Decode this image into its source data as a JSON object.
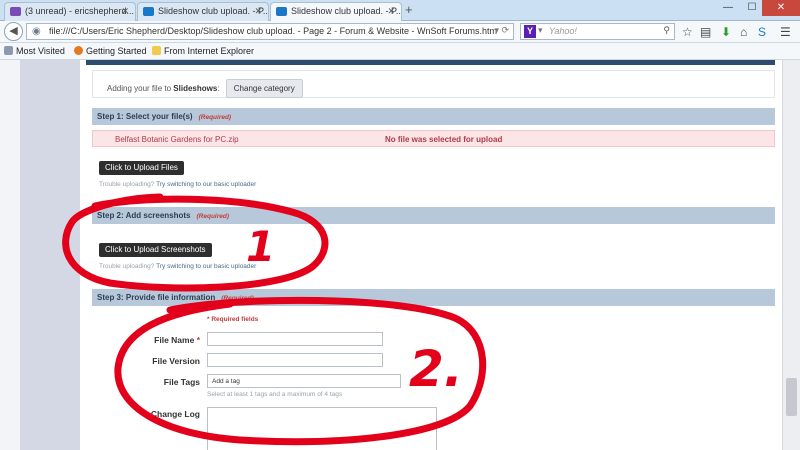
{
  "browser": {
    "tabs": [
      {
        "label": "(3 unread) - ericshepherd...",
        "icon": "mail-icon",
        "color": "#7b4ab2",
        "active": false
      },
      {
        "label": "Slideshow club upload. - P...",
        "icon": "page-icon",
        "color": "#1b78c7",
        "active": false
      },
      {
        "label": "Slideshow club upload. - P...",
        "icon": "page-icon",
        "color": "#1b78c7",
        "active": true
      }
    ],
    "new_tab": "+",
    "window_buttons": {
      "minimize": "—",
      "maximize": "☐",
      "close": "✕"
    },
    "url": "file:///C:/Users/Eric Shepherd/Desktop/Slideshow club upload. - Page 2 - Forum & Website - WnSoft Forums.htm",
    "search": {
      "placeholder": "Yahoo!",
      "provider": "Y"
    },
    "bookmarks": [
      "Most Visited",
      "Getting Started",
      "From Internet Explorer"
    ]
  },
  "page": {
    "adding_prefix": "Adding your file to",
    "category": "Slideshows",
    "change_category": "Change category",
    "step1": {
      "title": "Step 1: Select your file(s)",
      "req": "(Required)"
    },
    "file_error": {
      "filename": "Belfast Botanic Gardens for PC.zip",
      "message": "No file was selected for upload"
    },
    "upload_files_btn": "Click to Upload Files",
    "trouble_text": "Trouble uploading?",
    "switch_link": "Try switching to our basic uploader",
    "step2": {
      "title": "Step 2: Add screenshots",
      "req": "(Required)"
    },
    "upload_screens_btn": "Click to Upload Screenshots",
    "step3": {
      "title": "Step 3: Provide file information",
      "req": "(Required)"
    },
    "required_note": "* Required fields",
    "fields": {
      "file_name": "File Name",
      "required_star": "*",
      "file_version": "File Version",
      "file_tags": "File Tags",
      "tags_placeholder": "Add a tag",
      "tags_hint": "Select at least 1 tags and a maximum of 4 tags",
      "change_log": "Change Log"
    }
  },
  "annotations": {
    "one": "1",
    "two": "2.",
    "color": "#e3001b"
  }
}
